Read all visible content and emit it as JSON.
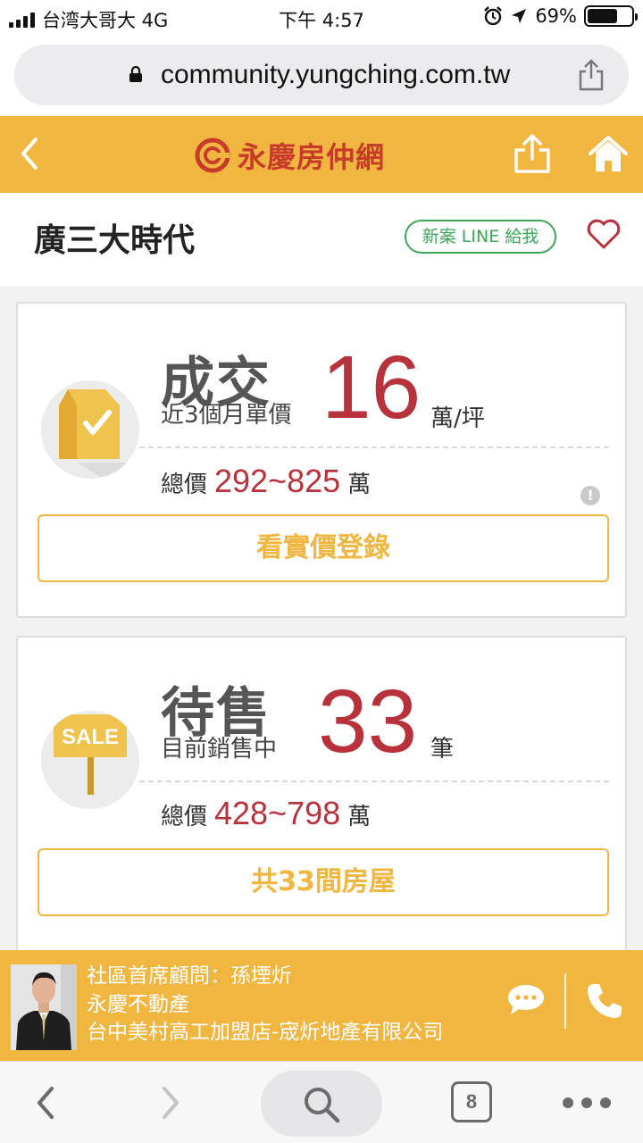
{
  "status_bar": {
    "carrier": "台湾大哥大 4G",
    "time": "下午 4:57",
    "battery": "69%",
    "battery_level": 0.69
  },
  "browser": {
    "url": "community.yungching.com.tw",
    "open_tabs": "8"
  },
  "site_header": {
    "logo_text": "永慶房仲網",
    "brand_color": "#f0b63f"
  },
  "community": {
    "name": "廣三大時代",
    "line_button": "新案 LINE 給我"
  },
  "sold_card": {
    "heading": "成交",
    "subheading": "近3個月單價",
    "value": "16",
    "unit": "萬/坪",
    "total_label": "總價",
    "total_range": "292~825",
    "total_unit": "萬",
    "info_mark": "!",
    "button": "看實價登錄"
  },
  "sale_card": {
    "heading": "待售",
    "subheading": "目前銷售中",
    "value": "33",
    "unit": "筆",
    "sign_text": "SALE",
    "total_label": "總價",
    "total_range": "428~798",
    "total_unit": "萬",
    "button": "共33間房屋"
  },
  "agent": {
    "line1": "社區首席顧問：孫堙炘",
    "line2": "永慶不動產",
    "line3": "台中美村高工加盟店-宬炘地產有限公司"
  },
  "colors": {
    "accent_red": "#b8323c",
    "line_green": "#3aa857"
  }
}
